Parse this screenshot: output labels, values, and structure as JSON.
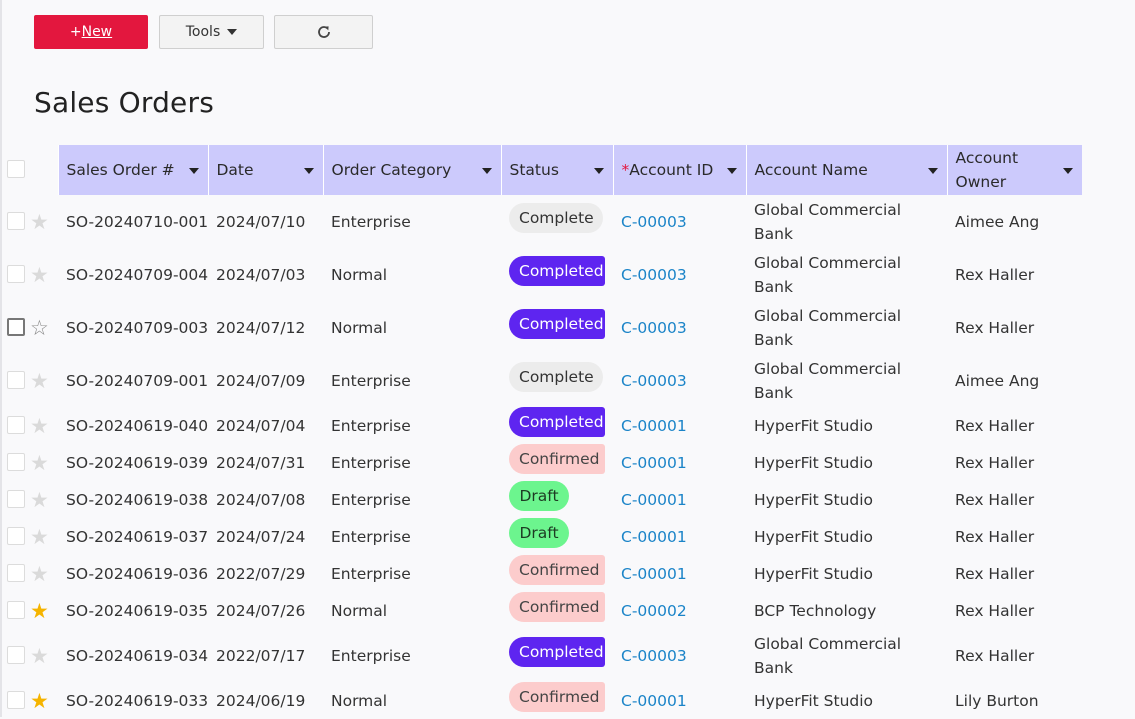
{
  "toolbar": {
    "new_plus": "+",
    "new_label": "New",
    "tools_label": "Tools"
  },
  "page_title": "Sales Orders",
  "columns": {
    "sales_order": "Sales Order #",
    "date": "Date",
    "order_category": "Order Category",
    "status": "Status",
    "account_id_required": "*",
    "account_id": "Account ID",
    "account_name": "Account Name",
    "account_owner": "Account Owner"
  },
  "rows": [
    {
      "so": "SO-20240710-001",
      "date": "2024/07/10",
      "category": "Enterprise",
      "status": "Complete",
      "account_id": "C-00003",
      "account_name": "Global Commercial Bank",
      "owner": "Aimee Ang",
      "starred": false
    },
    {
      "so": "SO-20240709-004",
      "date": "2024/07/03",
      "category": "Normal",
      "status": "Completed",
      "account_id": "C-00003",
      "account_name": "Global Commercial Bank",
      "owner": "Rex Haller",
      "starred": false
    },
    {
      "so": "SO-20240709-003",
      "date": "2024/07/12",
      "category": "Normal",
      "status": "Completed",
      "account_id": "C-00003",
      "account_name": "Global Commercial Bank",
      "owner": "Rex Haller",
      "starred": false
    },
    {
      "so": "SO-20240709-001",
      "date": "2024/07/09",
      "category": "Enterprise",
      "status": "Complete",
      "account_id": "C-00003",
      "account_name": "Global Commercial Bank",
      "owner": "Aimee Ang",
      "starred": false
    },
    {
      "so": "SO-20240619-040",
      "date": "2024/07/04",
      "category": "Enterprise",
      "status": "Completed",
      "account_id": "C-00001",
      "account_name": "HyperFit Studio",
      "owner": "Rex Haller",
      "starred": false
    },
    {
      "so": "SO-20240619-039",
      "date": "2024/07/31",
      "category": "Enterprise",
      "status": "Confirmed",
      "account_id": "C-00001",
      "account_name": "HyperFit Studio",
      "owner": "Rex Haller",
      "starred": false
    },
    {
      "so": "SO-20240619-038",
      "date": "2024/07/08",
      "category": "Enterprise",
      "status": "Draft",
      "account_id": "C-00001",
      "account_name": "HyperFit Studio",
      "owner": "Rex Haller",
      "starred": false
    },
    {
      "so": "SO-20240619-037",
      "date": "2024/07/24",
      "category": "Enterprise",
      "status": "Draft",
      "account_id": "C-00001",
      "account_name": "HyperFit Studio",
      "owner": "Rex Haller",
      "starred": false
    },
    {
      "so": "SO-20240619-036",
      "date": "2022/07/29",
      "category": "Enterprise",
      "status": "Confirmed",
      "account_id": "C-00001",
      "account_name": "HyperFit Studio",
      "owner": "Rex Haller",
      "starred": false
    },
    {
      "so": "SO-20240619-035",
      "date": "2024/07/26",
      "category": "Normal",
      "status": "Confirmed",
      "account_id": "C-00002",
      "account_name": "BCP Technology",
      "owner": "Rex Haller",
      "starred": true
    },
    {
      "so": "SO-20240619-034",
      "date": "2022/07/17",
      "category": "Enterprise",
      "status": "Completed",
      "account_id": "C-00003",
      "account_name": "Global Commercial Bank",
      "owner": "Rex Haller",
      "starred": false
    },
    {
      "so": "SO-20240619-033",
      "date": "2024/06/19",
      "category": "Normal",
      "status": "Confirmed",
      "account_id": "C-00001",
      "account_name": "HyperFit Studio",
      "owner": "Lily Burton",
      "starred": true
    }
  ],
  "status_colors": {
    "Complete": "#ececec",
    "Completed": "#5e25f0",
    "Confirmed": "#fccccc",
    "Draft": "#6cf58e"
  },
  "colors": {
    "primary_button": "#e3173e",
    "header_background": "#cccafc",
    "link": "#1b84c8",
    "star_active": "#f5b400"
  },
  "icons": {
    "tools_dropdown": "caret-down-icon",
    "refresh": "refresh-icon",
    "row_select": "checkbox-icon",
    "row_favorite": "star-icon"
  }
}
